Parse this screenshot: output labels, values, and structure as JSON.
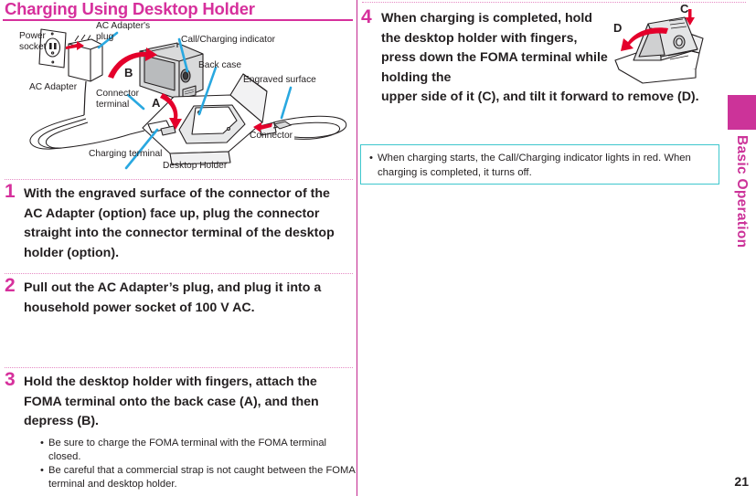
{
  "page": {
    "title": "Charging Using Desktop Holder",
    "number": "21",
    "accent_color": "#cc3399",
    "note_border_color": "#3ec7cd",
    "text_color": "#231f20"
  },
  "side_tab": {
    "label": "Basic Operation"
  },
  "figure_main": {
    "labels": [
      {
        "id": "power-socket",
        "text": "Power\nsocket"
      },
      {
        "id": "ac-adapters-plug",
        "text": "AC Adapter's\nplug"
      },
      {
        "id": "ac-adapter",
        "text": "AC Adapter"
      },
      {
        "id": "connector-terminal",
        "text": "Connector\nterminal"
      },
      {
        "id": "charging-terminal",
        "text": "Charging terminal"
      },
      {
        "id": "desktop-holder",
        "text": "Desktop Holder"
      },
      {
        "id": "call-charging-indicator",
        "text": "Call/Charging indicator"
      },
      {
        "id": "back-case",
        "text": "Back case"
      },
      {
        "id": "engraved-surface",
        "text": "Engraved surface"
      },
      {
        "id": "connector",
        "text": "Connector"
      }
    ],
    "callout_a": "A",
    "callout_b": "B"
  },
  "figure_step4": {
    "callout_c": "C",
    "callout_d": "D"
  },
  "steps": [
    {
      "number": "1",
      "text": "With the engraved surface of the connector of the AC Adapter (option) face up, plug the connector straight into the connector terminal of the desktop holder (option).",
      "notes": []
    },
    {
      "number": "2",
      "text": "Pull out the AC Adapter’s plug, and plug it into a household power socket of 100 V AC.",
      "notes": []
    },
    {
      "number": "3",
      "text": "Hold the desktop holder with fingers, attach the FOMA terminal onto the back case (A), and then depress (B).",
      "notes": [
        "Be sure to charge the FOMA terminal with the FOMA terminal closed.",
        "Be careful that a commercial strap is not caught between the FOMA terminal and desktop holder."
      ]
    },
    {
      "number": "4",
      "text_part1": "When charging is completed, hold the desktop holder with fingers, press down the FOMA terminal while holding the",
      "text_part2": "upper side of it (C), and tilt it forward to remove (D)."
    }
  ],
  "note_box": {
    "items": [
      "When charging starts, the Call/Charging indicator lights in red. When charging is completed, it turns off."
    ]
  }
}
